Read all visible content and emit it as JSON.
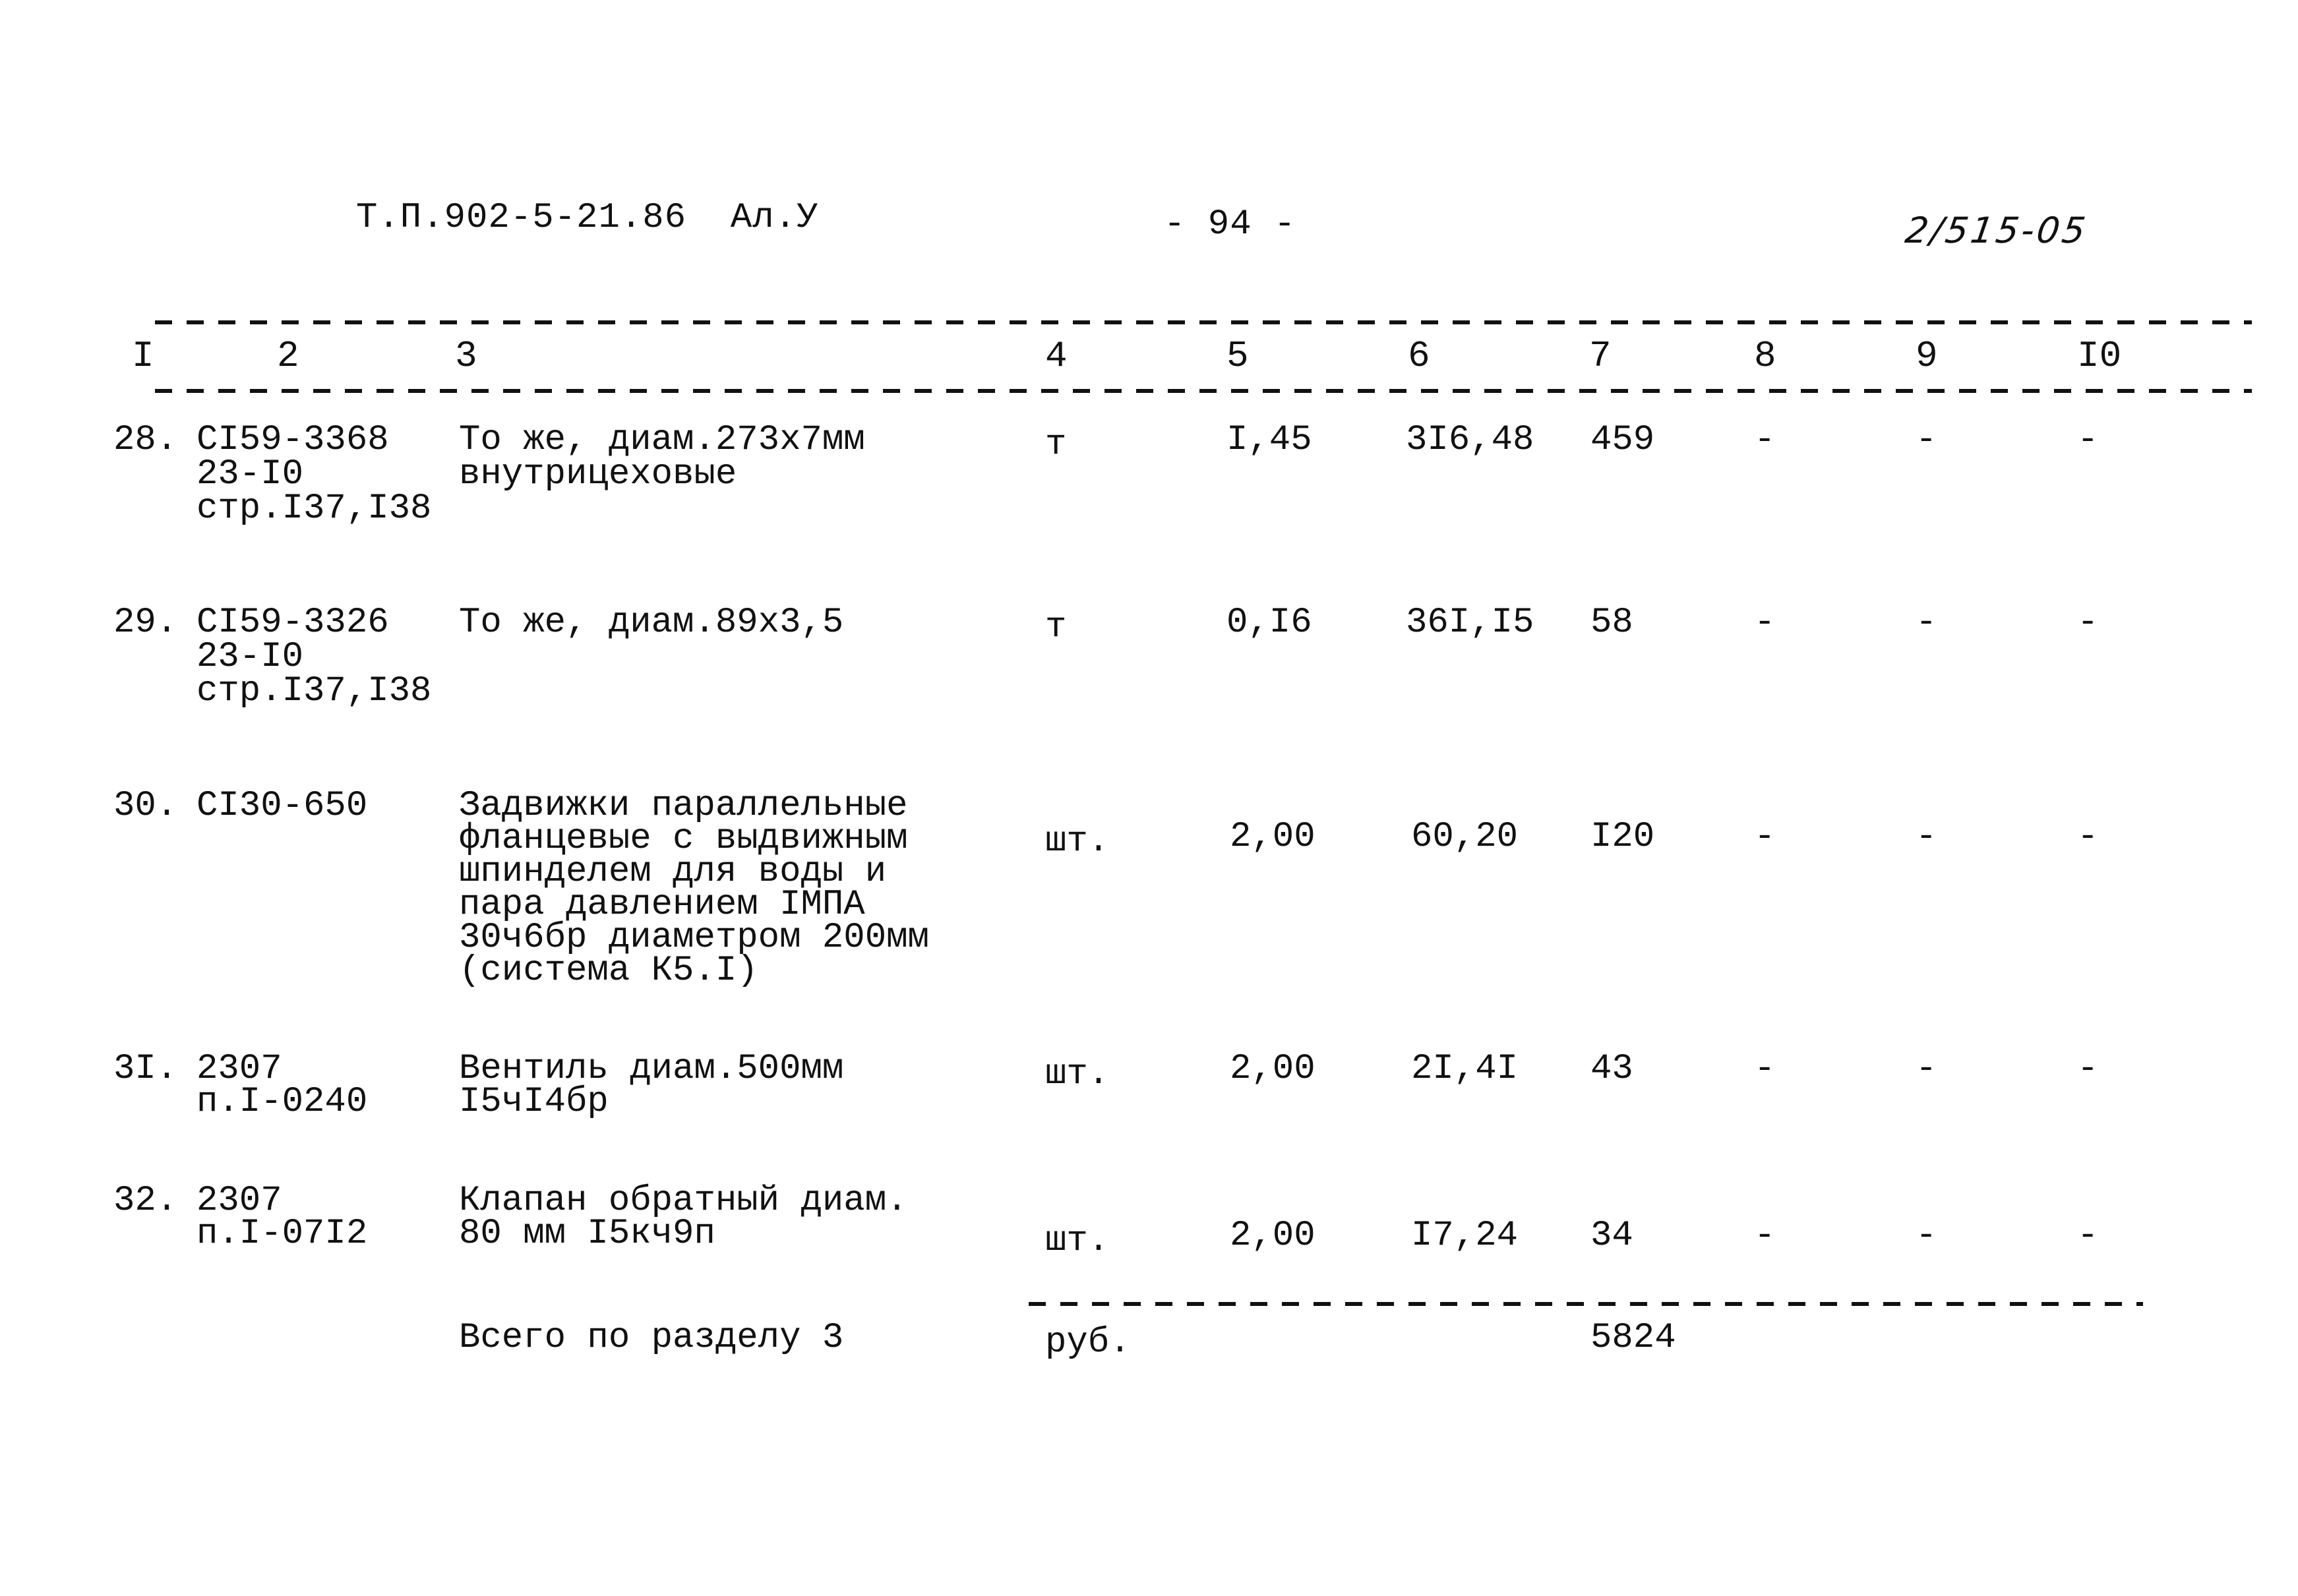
{
  "header": {
    "doc_code": "Т.П.902-5-21.86  Ал.У",
    "page_number": "- 94 -",
    "stamp": "2/515-05"
  },
  "columns": [
    "I",
    "2",
    "3",
    "4",
    "5",
    "6",
    "7",
    "8",
    "9",
    "I0"
  ],
  "rows": [
    {
      "no": "28.",
      "code": [
        "СI59-3368",
        "23-I0",
        "стр.I37,I38"
      ],
      "description": [
        "То же, диам.273х7мм",
        "внутрицеховые"
      ],
      "unit": "т",
      "qty": "I,45",
      "price": "3I6,48",
      "total": "459",
      "c8": "-",
      "c9": "-",
      "c10": "-"
    },
    {
      "no": "29.",
      "code": [
        "СI59-3326",
        "23-I0",
        "стр.I37,I38"
      ],
      "description": [
        "То же, диам.89х3,5"
      ],
      "unit": "т",
      "qty": "0,I6",
      "price": "36I,I5",
      "total": "58",
      "c8": "-",
      "c9": "-",
      "c10": "-"
    },
    {
      "no": "30.",
      "code": [
        "СI30-650"
      ],
      "description": [
        "Задвижки параллельные",
        "фланцевые с выдвижным",
        "шпинделем для воды и",
        "пара давлением IМПА",
        "30ч6бр диаметром 200мм",
        "(система К5.I)"
      ],
      "unit": "шт.",
      "qty": "2,00",
      "price": "60,20",
      "total": "I20",
      "c8": "-",
      "c9": "-",
      "c10": "-"
    },
    {
      "no": "3I.",
      "code": [
        "2307",
        "п.I-0240"
      ],
      "description": [
        "Вентиль диам.500мм",
        "I5чI4бр"
      ],
      "unit": "шт.",
      "qty": "2,00",
      "price": "2I,4I",
      "total": "43",
      "c8": "-",
      "c9": "-",
      "c10": "-"
    },
    {
      "no": "32.",
      "code": [
        "2307",
        "п.I-07I2"
      ],
      "description": [
        "Клапан обратный диам.",
        "80 мм I5кч9п"
      ],
      "unit": "шт.",
      "qty": "2,00",
      "price": "I7,24",
      "total": "34",
      "c8": "-",
      "c9": "-",
      "c10": "-"
    }
  ],
  "summary": {
    "label": "Всего по разделу 3",
    "unit": "руб.",
    "total": "5824"
  }
}
